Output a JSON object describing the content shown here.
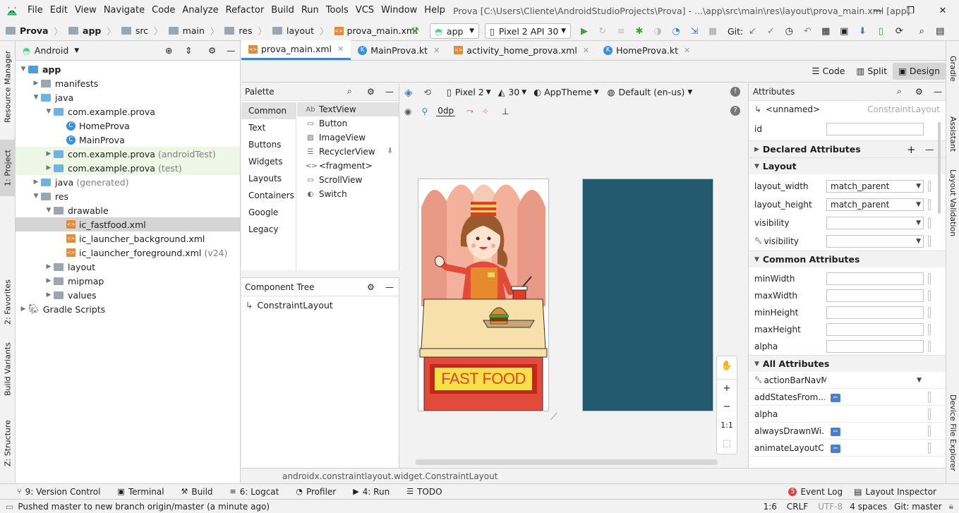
{
  "menu": [
    "File",
    "Edit",
    "View",
    "Navigate",
    "Code",
    "Analyze",
    "Refactor",
    "Build",
    "Run",
    "Tools",
    "VCS",
    "Window",
    "Help"
  ],
  "window_title": "Prova [C:\\Users\\Cliente\\AndroidStudioProjects\\Prova] - ...\\app\\src\\main\\res\\layout\\prova_main.xml [app]",
  "breadcrumb": [
    "Prova",
    "app",
    "src",
    "main",
    "res",
    "layout",
    "prova_main.xml"
  ],
  "run_config": "app",
  "device": "Pixel 2 API 30",
  "git_label": "Git:",
  "project": {
    "view": "Android",
    "tree": [
      {
        "label": "app",
        "indent": 0,
        "arrow": "▼",
        "bold": true,
        "icon": "folder"
      },
      {
        "label": "manifests",
        "indent": 1,
        "arrow": "▶",
        "icon": "folder"
      },
      {
        "label": "java",
        "indent": 1,
        "arrow": "▼",
        "icon": "folder"
      },
      {
        "label": "com.example.prova",
        "indent": 2,
        "arrow": "▼",
        "icon": "folder"
      },
      {
        "label": "HomeProva",
        "indent": 3,
        "arrow": "",
        "icon": "kotlin"
      },
      {
        "label": "MainProva",
        "indent": 3,
        "arrow": "",
        "icon": "kotlin"
      },
      {
        "label": "com.example.prova",
        "suffix": "(androidTest)",
        "indent": 2,
        "arrow": "▶",
        "icon": "folder",
        "green": true
      },
      {
        "label": "com.example.prova",
        "suffix": "(test)",
        "indent": 2,
        "arrow": "▶",
        "icon": "folder",
        "green": true
      },
      {
        "label": "java",
        "suffix": "(generated)",
        "indent": 1,
        "arrow": "▶",
        "icon": "folder"
      },
      {
        "label": "res",
        "indent": 1,
        "arrow": "▼",
        "icon": "folder"
      },
      {
        "label": "drawable",
        "indent": 2,
        "arrow": "▼",
        "icon": "folder"
      },
      {
        "label": "ic_fastfood.xml",
        "indent": 3,
        "arrow": "",
        "icon": "xml",
        "selected": true
      },
      {
        "label": "ic_launcher_background.xml",
        "indent": 3,
        "arrow": "",
        "icon": "xml"
      },
      {
        "label": "ic_launcher_foreground.xml",
        "suffix": "(v24)",
        "indent": 3,
        "arrow": "",
        "icon": "xml"
      },
      {
        "label": "layout",
        "indent": 2,
        "arrow": "▶",
        "icon": "folder"
      },
      {
        "label": "mipmap",
        "indent": 2,
        "arrow": "▶",
        "icon": "folder"
      },
      {
        "label": "values",
        "indent": 2,
        "arrow": "▶",
        "icon": "folder"
      },
      {
        "label": "Gradle Scripts",
        "indent": 0,
        "arrow": "▶",
        "icon": "gradle"
      }
    ]
  },
  "left_tabs": [
    "Resource Manager",
    "1: Project",
    "2: Favorites",
    "Build Variants",
    "Z: Structure"
  ],
  "right_tabs": [
    "Gradle",
    "Assistant",
    "Layout Validation",
    "Device File Explorer"
  ],
  "editor_tabs": [
    {
      "label": "prova_main.xml",
      "icon": "xml",
      "active": true
    },
    {
      "label": "MainProva.kt",
      "icon": "kotlin"
    },
    {
      "label": "activity_home_prova.xml",
      "icon": "xml"
    },
    {
      "label": "HomeProva.kt",
      "icon": "kotlin"
    }
  ],
  "view_modes": [
    "Code",
    "Split",
    "Design"
  ],
  "palette": {
    "title": "Palette",
    "categories": [
      "Common",
      "Text",
      "Buttons",
      "Widgets",
      "Layouts",
      "Containers",
      "Google",
      "Legacy"
    ],
    "items": [
      {
        "label": "TextView",
        "icon": "Ab"
      },
      {
        "label": "Button",
        "icon": "▭"
      },
      {
        "label": "ImageView",
        "icon": "▨"
      },
      {
        "label": "RecyclerView",
        "icon": "☰"
      },
      {
        "label": "<fragment>",
        "icon": "<>"
      },
      {
        "label": "ScrollView",
        "icon": "▭"
      },
      {
        "label": "Switch",
        "icon": "◐"
      }
    ]
  },
  "component_tree": {
    "title": "Component Tree",
    "root": "ConstraintLayout"
  },
  "canvas_toolbar": {
    "device": "Pixel 2",
    "api": "30",
    "theme": "AppTheme",
    "locale": "Default (en-us)",
    "margin": "0dp"
  },
  "design": {
    "sign_text": "FAST FOOD"
  },
  "zoom": [
    "✋",
    "+",
    "−",
    "1:1",
    "⬚"
  ],
  "attributes": {
    "title": "Attributes",
    "component": "<unnamed>",
    "component_type": "ConstraintLayout",
    "id_label": "id",
    "declared": "Declared Attributes",
    "layout_section": "Layout",
    "layout_rows": [
      {
        "name": "layout_width",
        "value": "match_parent",
        "dropdown": true
      },
      {
        "name": "layout_height",
        "value": "match_parent",
        "dropdown": true
      },
      {
        "name": "visibility",
        "value": "",
        "dropdown": true
      },
      {
        "name": "visibility",
        "value": "",
        "dropdown": true,
        "tool": true
      }
    ],
    "common_section": "Common Attributes",
    "common_rows": [
      "minWidth",
      "maxWidth",
      "minHeight",
      "maxHeight",
      "alpha"
    ],
    "all_section": "All Attributes",
    "all_rows": [
      {
        "name": "actionBarNavM...",
        "tool": true,
        "dropdown": true
      },
      {
        "name": "addStatesFrom...",
        "flag": true
      },
      {
        "name": "alpha"
      },
      {
        "name": "alwaysDrawnWi...",
        "flag": true
      },
      {
        "name": "animateLayoutC...",
        "flag": true
      }
    ]
  },
  "status_class": "androidx.constraintlayout.widget.ConstraintLayout",
  "bottom_tools": [
    {
      "label": "9: Version Control",
      "icon": "⑂"
    },
    {
      "label": "Terminal",
      "icon": "▣"
    },
    {
      "label": "Build",
      "icon": "⚒"
    },
    {
      "label": "6: Logcat",
      "icon": "≡"
    },
    {
      "label": "Profiler",
      "icon": "◔"
    },
    {
      "label": "4: Run",
      "icon": "▶"
    },
    {
      "label": "TODO",
      "icon": "☰"
    }
  ],
  "event_log_count": "5",
  "event_log": "Event Log",
  "layout_inspector": "Layout Inspector",
  "status_message": "Pushed master to new branch origin/master (a minute ago)",
  "status_right": [
    "1:6",
    "CRLF",
    "UTF-8",
    "4 spaces",
    "Git: master"
  ],
  "colors": {
    "accent": "#4083c9",
    "blueprint": "#235a6e",
    "selection": "#d5d5d5"
  }
}
